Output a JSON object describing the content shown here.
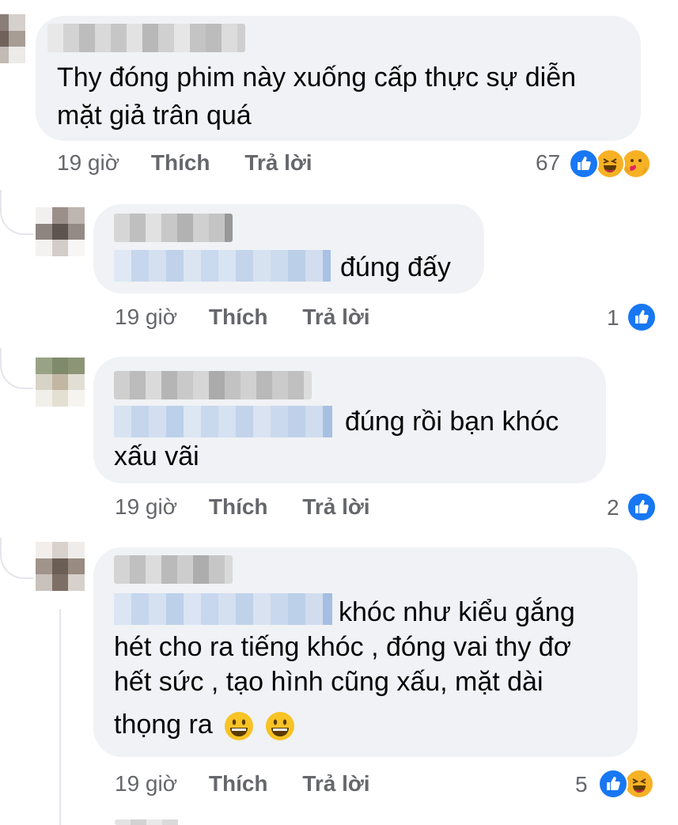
{
  "comments": [
    {
      "text": "Thy đóng phim này xuống cấp thực sự diễn mặt giả trân quá",
      "line1": "Thy đóng phim này xuống cấp thực sự diễn",
      "line2": "mặt giả trân quá",
      "time": "19 giờ",
      "like_label": "Thích",
      "reply_label": "Trả lời",
      "reaction_count": "67",
      "reactions": [
        "like-icon",
        "haha-icon",
        "care-icon"
      ]
    },
    {
      "text": "đúng đấy",
      "time": "19 giờ",
      "like_label": "Thích",
      "reply_label": "Trả lời",
      "reaction_count": "1",
      "reactions": [
        "like-icon"
      ]
    },
    {
      "text": "đúng rồi bạn khóc xấu vãi",
      "line1": "đúng rồi bạn khóc",
      "line2": "xấu vãi",
      "time": "19 giờ",
      "like_label": "Thích",
      "reply_label": "Trả lời",
      "reaction_count": "2",
      "reactions": [
        "like-icon"
      ]
    },
    {
      "text": "khóc như kiểu gắng hét cho ra tiếng khóc , đóng vai thy đơ hết sức , tạo hình cũng xấu, mặt dài thọng ra",
      "line1": "khóc như kiểu gắng",
      "line2": "hét cho ra tiếng khóc , đóng vai thy đơ",
      "line3": "hết sức , tạo hình cũng xấu, mặt dài",
      "line4": "thọng ra",
      "time": "19 giờ",
      "like_label": "Thích",
      "reply_label": "Trả lời",
      "reaction_count": "5",
      "reactions": [
        "like-icon",
        "haha-icon"
      ]
    }
  ],
  "colors": {
    "bubble": "#f0f2f5",
    "meta": "#65676b",
    "like": "#1877f2",
    "haha": "#f7b125"
  }
}
